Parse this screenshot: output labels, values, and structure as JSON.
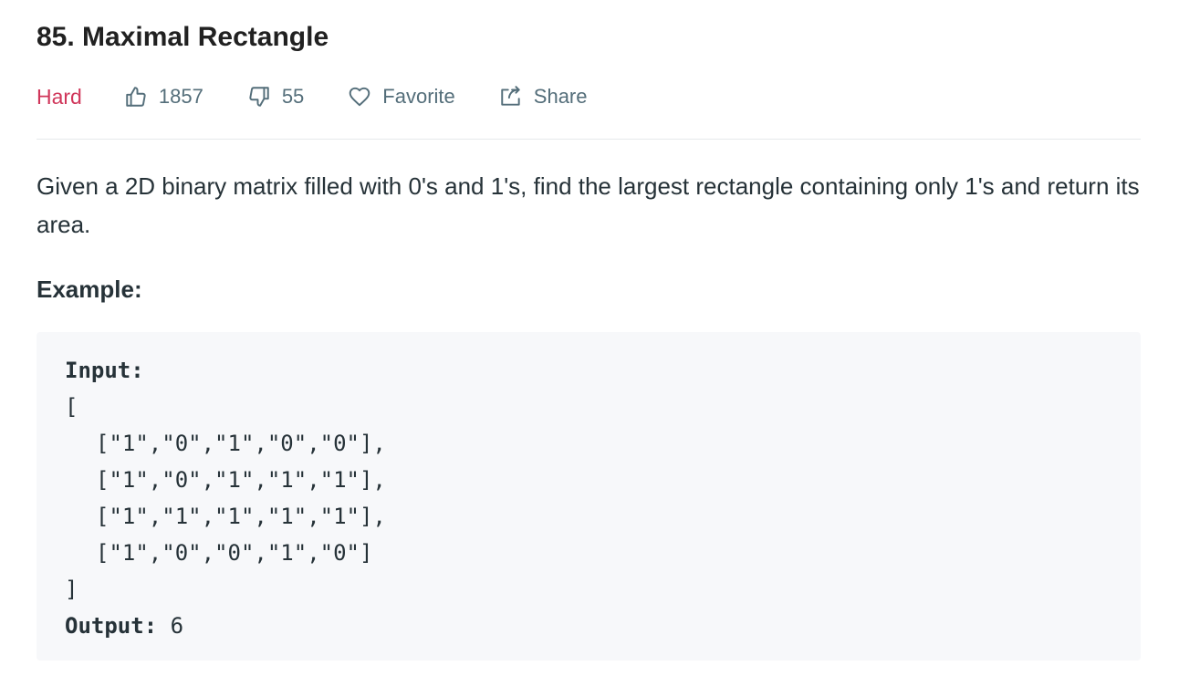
{
  "problem": {
    "title": "85. Maximal Rectangle",
    "difficulty": "Hard",
    "likes": "1857",
    "dislikes": "55",
    "favorite_label": "Favorite",
    "share_label": "Share"
  },
  "icons": {
    "like": "thumbs-up-icon",
    "dislike": "thumbs-down-icon",
    "favorite": "heart-icon",
    "share": "share-icon"
  },
  "colors": {
    "difficulty": "#d0365a",
    "meta_text": "#546e7a",
    "code_background": "#f7f8fa"
  },
  "description": "Given a 2D binary matrix filled with 0's and 1's, find the largest rectangle containing only 1's and return its area.",
  "example": {
    "label": "Example:",
    "input_label": "Input:",
    "open_bracket": "[",
    "rows": [
      "[\"1\",\"0\",\"1\",\"0\",\"0\"],",
      "[\"1\",\"0\",\"1\",\"1\",\"1\"],",
      "[\"1\",\"1\",\"1\",\"1\",\"1\"],",
      "[\"1\",\"0\",\"0\",\"1\",\"0\"]"
    ],
    "close_bracket": "]",
    "output_label": "Output:",
    "output_value": "6"
  }
}
